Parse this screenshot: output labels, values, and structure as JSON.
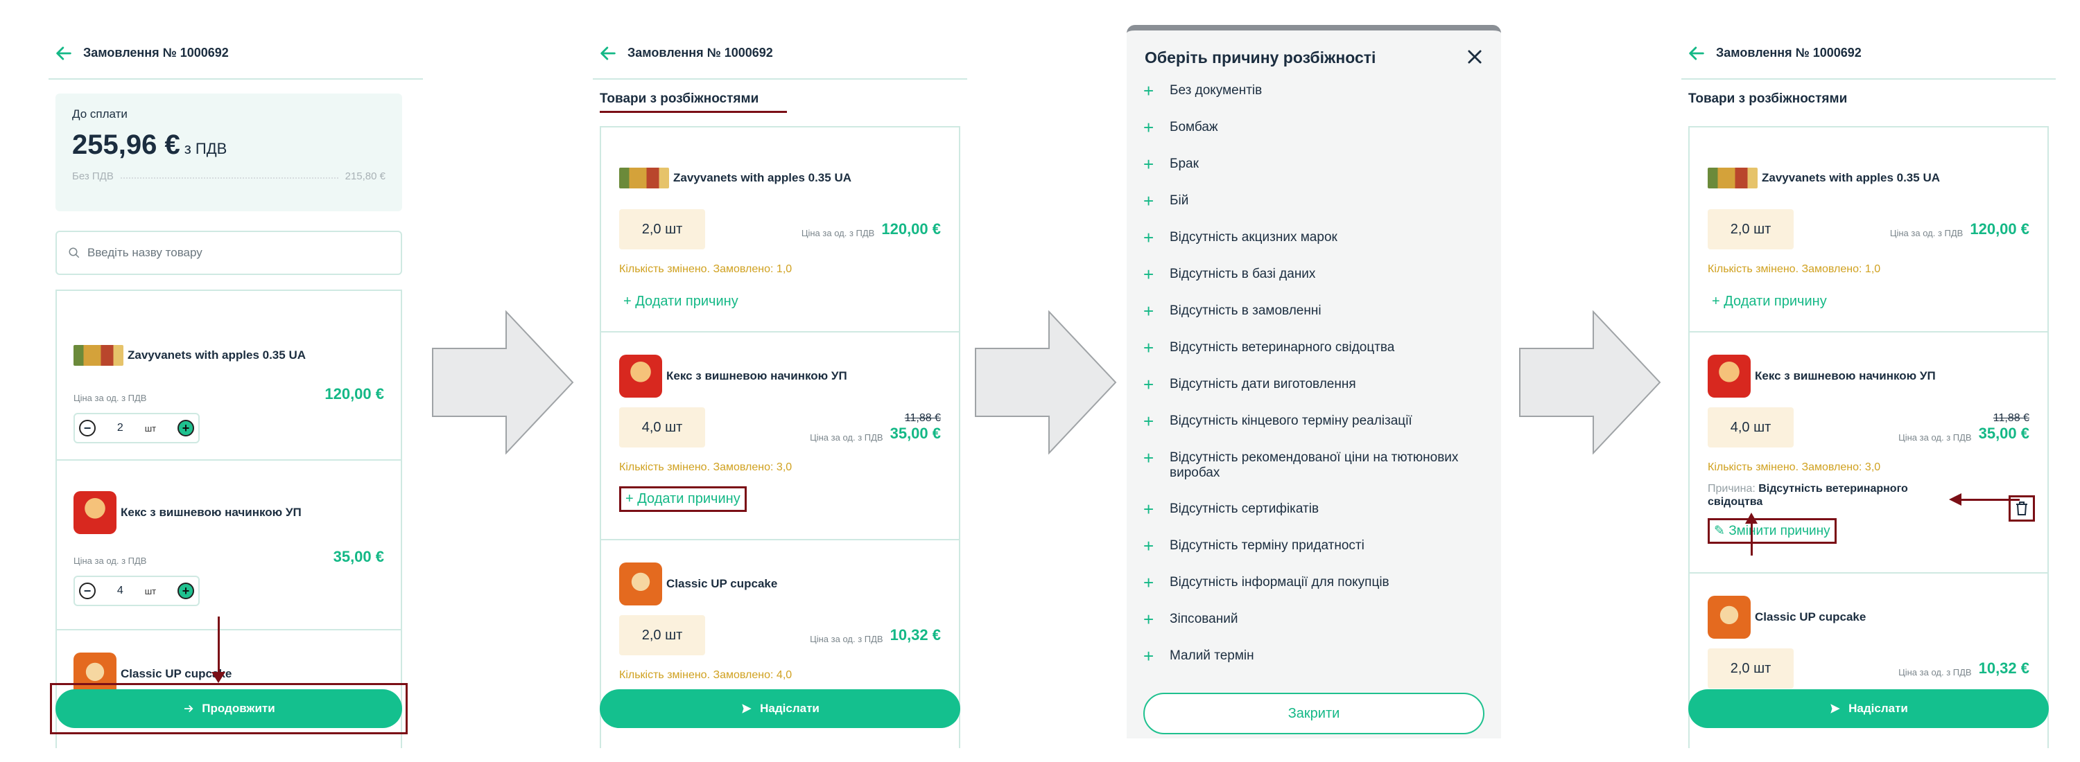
{
  "order_title": "Замовлення № 1000692",
  "screen1": {
    "pay_label": "До сплати",
    "pay_amount": "255,96 €",
    "pay_vat": "з ПДВ",
    "net_label": "Без ПДВ",
    "net_value": "215,80 €",
    "search_placeholder": "Введіть назву товару",
    "unit_label": "Ціна за од. з ПДВ",
    "qty_unit": "шт",
    "items": [
      {
        "name": "Zavyvanets with apples 0.35 UA",
        "price": "120,00 €",
        "qty": "2"
      },
      {
        "name": "Кекс з вишневою начинкою УП",
        "price": "35,00 €",
        "qty": "4"
      },
      {
        "name": "Classic UP cupcake"
      }
    ],
    "cta": "Продовжити"
  },
  "screen2": {
    "section_title": "Товари з розбіжностями",
    "unit_label": "Ціна за од. з ПДВ",
    "add_reason": "+ Додати причину",
    "items": [
      {
        "name": "Zavyvanets with apples 0.35 UA",
        "qty": "2,0 шт",
        "price": "120,00 €",
        "note": "Кількість змінено. Замовлено: 1,0"
      },
      {
        "name": "Кекс з вишневою начинкою УП",
        "qty": "4,0 шт",
        "old_price": "11,88 €",
        "price": "35,00 €",
        "note": "Кількість змінено. Замовлено: 3,0"
      },
      {
        "name": "Classic UP cupcake",
        "qty": "2,0 шт",
        "price": "10,32 €",
        "note": "Кількість змінено. Замовлено: 4,0"
      }
    ],
    "cta": "Надіслати"
  },
  "modal": {
    "title": "Оберіть причину розбіжності",
    "options": [
      "Без документів",
      "Бомбаж",
      "Брак",
      "Бій",
      "Відсутність акцизних марок",
      "Відсутність в базі даних",
      "Відсутність в замовленні",
      "Відсутність ветеринарного свідоцтва",
      "Відсутність дати виготовлення",
      "Відсутність кінцевого терміну реалізації",
      "Відсутність рекомендованої ціни на тютюнових виробах",
      "Відсутність сертифікатів",
      "Відсутність терміну придатності",
      "Відсутність інформації для покупців",
      "Зіпсований",
      "Малий термін"
    ],
    "close_label": "Закрити"
  },
  "screen4": {
    "reason_label": "Причина:",
    "reason_value": "Відсутність ветеринарного свідоцтва",
    "change_reason": "Змінити причину"
  },
  "colors": {
    "accent": "#14b886",
    "highlight": "#7b0f16",
    "warning": "#d0a120",
    "qty_bg": "#fbf1dd"
  }
}
